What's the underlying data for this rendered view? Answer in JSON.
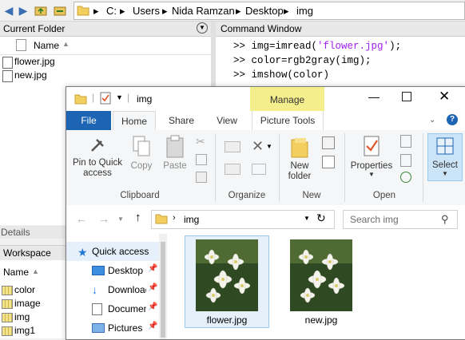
{
  "matlab": {
    "path": [
      "C:",
      "Users",
      "Nida Ramzan",
      "Desktop",
      "img"
    ],
    "current_folder": {
      "title": "Current Folder",
      "column": "Name",
      "files": [
        "flower.jpg",
        "new.jpg"
      ]
    },
    "command_window": {
      "title": "Command Window",
      "prompt": ">>",
      "lines": [
        {
          "pre": "img=imread(",
          "str": "'flower.jpg'",
          "post": ");"
        },
        {
          "pre": "color=rgb2gray(img);",
          "str": "",
          "post": ""
        },
        {
          "pre": "imshow(color)",
          "str": "",
          "post": ""
        }
      ]
    },
    "details": {
      "title": "Details"
    },
    "workspace": {
      "title": "Workspace",
      "column": "Name",
      "vars": [
        "color",
        "image",
        "img",
        "img1"
      ]
    }
  },
  "explorer": {
    "title": "img",
    "context_tab": "Manage",
    "tabs": [
      "File",
      "Home",
      "Share",
      "View",
      "Picture Tools"
    ],
    "ribbon": {
      "pin_label": "Pin to Quick access",
      "copy_label": "Copy",
      "paste_label": "Paste",
      "clipboard_group": "Clipboard",
      "organize_group": "Organize",
      "new_folder_label": "New folder",
      "new_group": "New",
      "properties_label": "Properties",
      "open_group": "Open",
      "select_label": "Select"
    },
    "address": {
      "location": "img",
      "search_placeholder": "Search img"
    },
    "nav": [
      "Quick access",
      "Desktop",
      "Downloads",
      "Documents",
      "Pictures"
    ],
    "files": [
      "flower.jpg",
      "new.jpg"
    ]
  },
  "colors": {
    "file_tab": "#1e64b4",
    "manage_tab": "#f4ee8c",
    "string_purple": "#a020f0"
  }
}
